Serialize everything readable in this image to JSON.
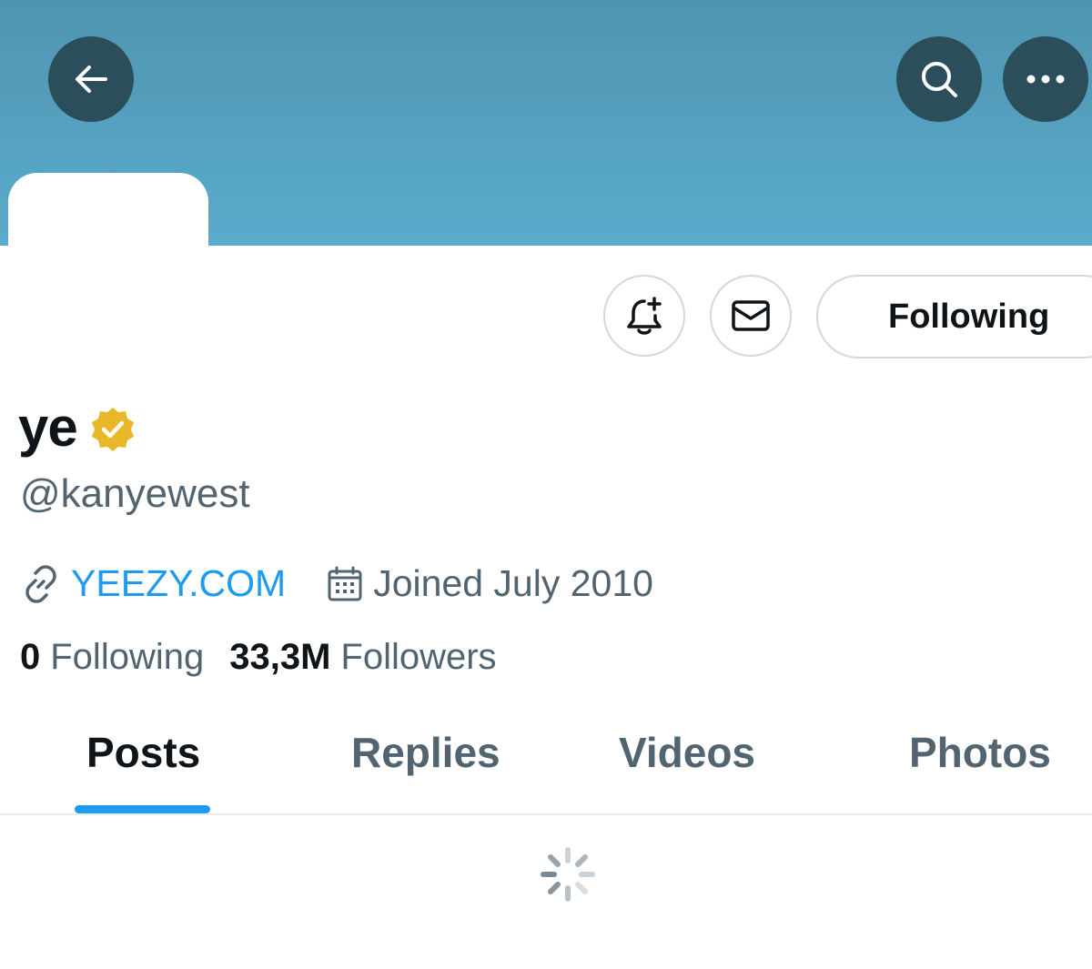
{
  "header": {
    "back_icon": "arrow-left-icon",
    "search_icon": "search-icon",
    "more_icon": "more-horizontal-icon"
  },
  "actions": {
    "notify_icon": "bell-plus-icon",
    "message_icon": "mail-icon",
    "following_label": "Following"
  },
  "profile": {
    "display_name": "ye",
    "verified_badge_color": "#e8b829",
    "handle": "@kanyewest",
    "website": "YEEZY.COM",
    "joined": "Joined July 2010",
    "following_count": "0",
    "following_label": "Following",
    "followers_count": "33,3M",
    "followers_label": "Followers"
  },
  "tabs": [
    {
      "label": "Posts",
      "active": true
    },
    {
      "label": "Replies",
      "active": false
    },
    {
      "label": "Videos",
      "active": false
    },
    {
      "label": "Photos",
      "active": false
    }
  ],
  "colors": {
    "accent": "#1d9bf0",
    "banner_top": "#4f94b0",
    "banner_bottom": "#5aaccc",
    "header_button": "#2c4d5a",
    "muted_text": "#536471",
    "primary_text": "#0f1419"
  }
}
